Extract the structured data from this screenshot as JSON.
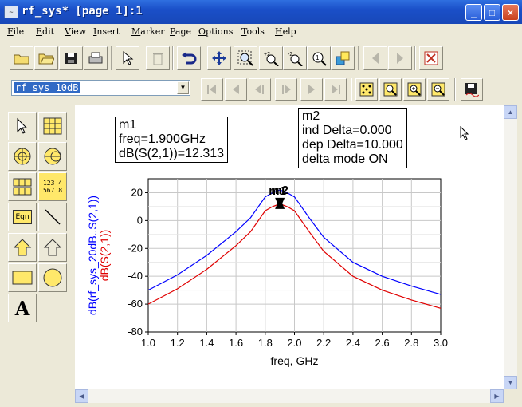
{
  "window": {
    "title": "rf_sys* [page 1]:1",
    "minimize": "_",
    "maximize": "□",
    "close": "×"
  },
  "menu": [
    "File",
    "Edit",
    "View",
    "Insert",
    "Marker",
    "Page",
    "Options",
    "Tools",
    "Help"
  ],
  "toolbar": {
    "buttons": [
      "new-icon",
      "open-icon",
      "save-icon",
      "print-icon",
      "select-pointer-icon",
      "delete-icon",
      "undo-icon",
      "move-icon",
      "zoom-area-icon",
      "zoom-in-icon",
      "zoom-out-icon",
      "zoom-one-icon",
      "view-all-icon",
      "previous-icon",
      "next-icon",
      "stop-icon"
    ]
  },
  "page_selector": {
    "value": "rf_sys_10dB"
  },
  "palette": {
    "items": [
      "select-pointer-icon",
      "rectangular-plot-icon",
      "polar-plot-icon",
      "smith-chart-icon",
      "stacked-plot-icon",
      "list-icon",
      "equation-icon",
      "line-icon",
      "polyline-icon",
      "polygon-icon",
      "rectangle-icon",
      "circle-icon",
      "text-icon"
    ],
    "list_label_a": "123 4",
    "list_label_b": "567 8",
    "eqn_label": "Eqn",
    "text_label": "A"
  },
  "markers": {
    "m1": {
      "name": "m1",
      "line1": "freq=1.900GHz",
      "line2": "dB(S(2,1))=12.313"
    },
    "m2": {
      "name": "m2",
      "line1": "ind Delta=0.000",
      "line2": "dep Delta=10.000",
      "line3": "delta mode ON"
    }
  },
  "colors": {
    "trace_blue": "#0000ff",
    "trace_red": "#e00000",
    "grid": "#c8c8c8"
  },
  "chart_data": {
    "type": "line",
    "xlabel": "freq, GHz",
    "ylabel_series": [
      "dB(rf_sys_20dB..S(2,1))",
      "dB(S(2,1))"
    ],
    "xlim": [
      1.0,
      3.0
    ],
    "ylim": [
      -80,
      30
    ],
    "x_ticks": [
      "1.0",
      "1.2",
      "1.4",
      "1.6",
      "1.8",
      "2.0",
      "2.2",
      "2.4",
      "2.6",
      "2.8",
      "3.0"
    ],
    "y_ticks": [
      "20",
      "0",
      "-20",
      "-40",
      "-60",
      "-80"
    ],
    "grid": true,
    "marker_labels": [
      "m1",
      "m2"
    ],
    "series": [
      {
        "name": "dB(rf_sys_20dB..S(2,1))",
        "color": "#0000ff",
        "x": [
          1.0,
          1.2,
          1.4,
          1.6,
          1.7,
          1.8,
          1.85,
          1.9,
          1.95,
          2.0,
          2.1,
          2.2,
          2.4,
          2.6,
          2.8,
          3.0
        ],
        "y": [
          -50,
          -39,
          -25,
          -8,
          2,
          17,
          20,
          22,
          20,
          17,
          2,
          -12,
          -30,
          -40,
          -47,
          -53
        ]
      },
      {
        "name": "dB(S(2,1))",
        "color": "#e00000",
        "x": [
          1.0,
          1.2,
          1.4,
          1.6,
          1.7,
          1.8,
          1.85,
          1.9,
          1.95,
          2.0,
          2.1,
          2.2,
          2.4,
          2.6,
          2.8,
          3.0
        ],
        "y": [
          -60,
          -49,
          -35,
          -18,
          -8,
          7,
          10,
          12,
          10,
          7,
          -8,
          -22,
          -40,
          -50,
          -57,
          -63
        ]
      }
    ]
  }
}
